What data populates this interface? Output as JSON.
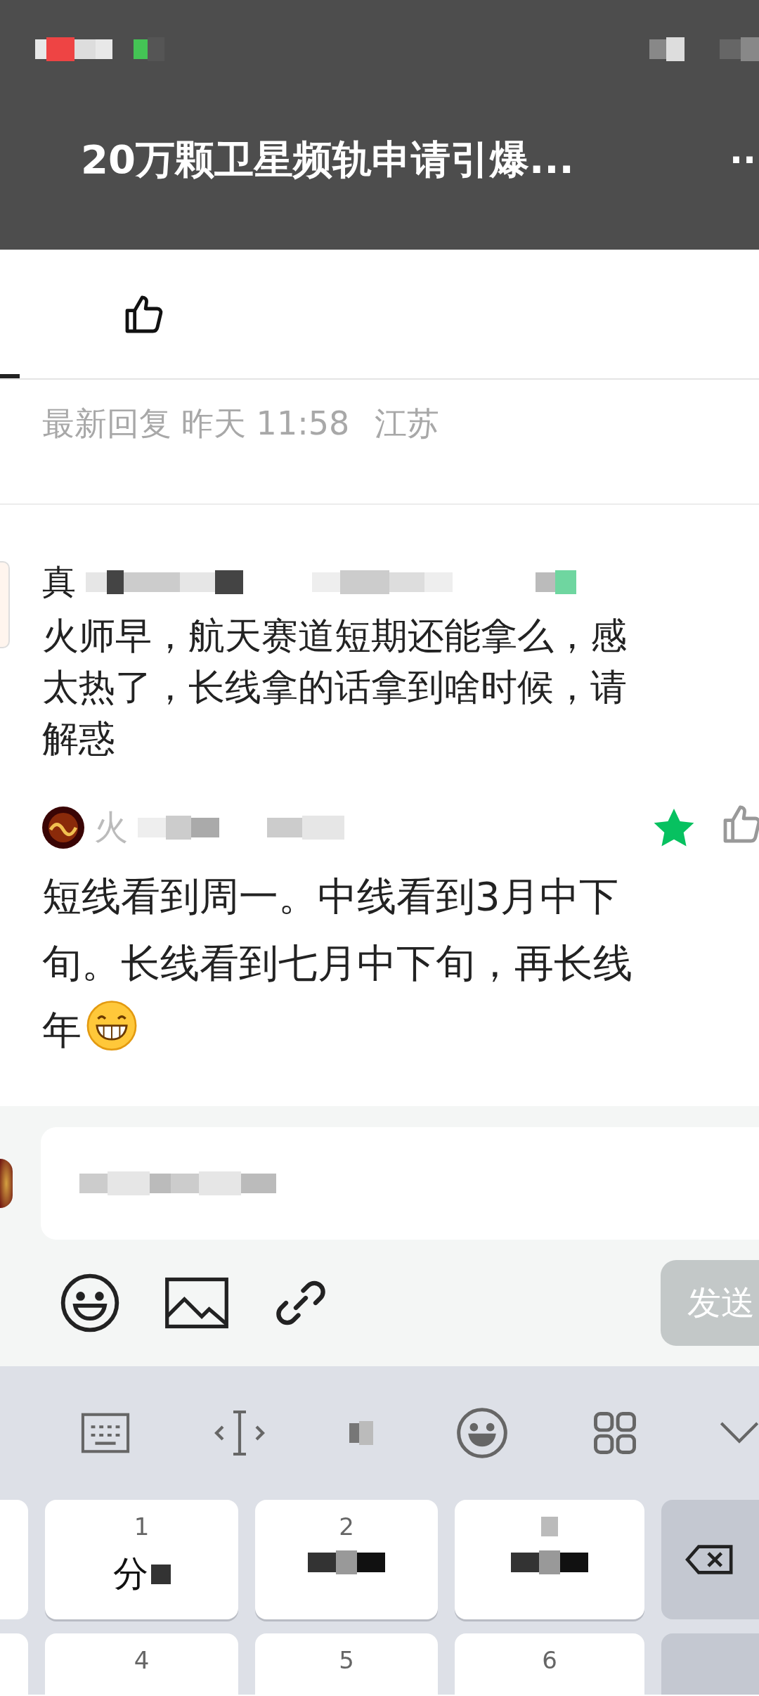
{
  "app_bar": {
    "title": "20万颗卫星频轨申请引爆...",
    "more": "··"
  },
  "tabs": [
    {
      "kind": "text",
      "selected": true
    },
    {
      "kind": "like",
      "selected": false
    }
  ],
  "meta": {
    "label": "最新回复",
    "date": "昨天 11:58",
    "region": "江苏"
  },
  "comments": [
    {
      "kind": "question",
      "name": "真",
      "lines": [
        "火师早，航天赛道短期还能拿么，感",
        "太热了，长线拿的话拿到啥时候，请",
        "解惑"
      ]
    },
    {
      "kind": "reply",
      "name": "火",
      "starred": true,
      "lines": [
        "短线看到周一。中线看到3月中下",
        "旬。长线看到七月中下旬，再长线",
        "年"
      ],
      "trailing_emoji": true
    }
  ],
  "composer": {
    "send": "发送",
    "send_enabled": false
  },
  "keyboard": {
    "rows": [
      [
        {
          "kind": "key",
          "number": "1",
          "label": "分"
        },
        {
          "kind": "key",
          "number": "2"
        },
        {
          "kind": "masked"
        }
      ],
      [
        {
          "kind": "key",
          "number": "4"
        },
        {
          "kind": "key",
          "number": "5"
        },
        {
          "kind": "key",
          "number": "6"
        }
      ]
    ]
  }
}
